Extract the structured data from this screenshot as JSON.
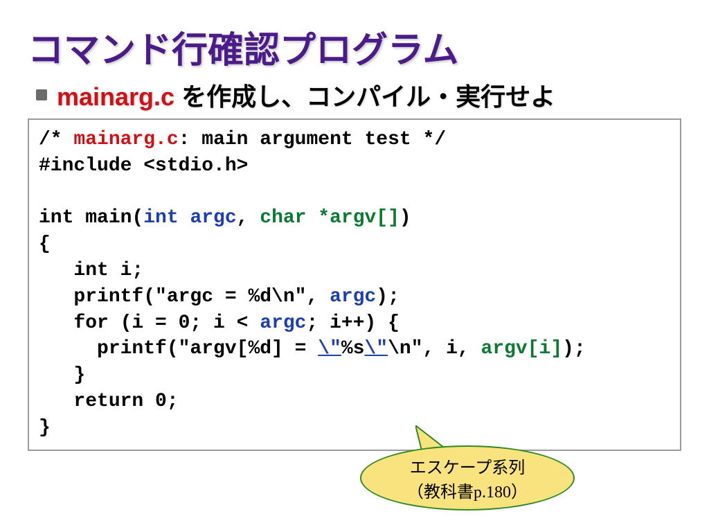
{
  "title": "コマンド行確認プログラム",
  "subtitle_prefix": "mainarg.c",
  "subtitle_rest": " を作成し、コンパイル・実行せよ",
  "code": {
    "l1_a": "/* ",
    "l1_b": "mainarg.c",
    "l1_c": ": main argument test */",
    "l2": "#include <stdio.h>",
    "l3": "",
    "l4_a": "int main(",
    "l4_b": "int argc",
    "l4_c": ", ",
    "l4_d": "char *argv[]",
    "l4_e": ")",
    "l5": "{",
    "l6": "   int i;",
    "l7_a": "   printf(\"argc = %d\\n\", ",
    "l7_b": "argc",
    "l7_c": ");",
    "l8_a": "   for (i = 0; i < ",
    "l8_b": "argc",
    "l8_c": "; i++) {",
    "l9_a": "     printf(\"argv[%d] = ",
    "l9_b": "\\\"",
    "l9_c": "%s",
    "l9_d": "\\\"",
    "l9_e": "\\n\", i, ",
    "l9_f": "argv[i]",
    "l9_g": ");",
    "l10": "   }",
    "l11": "   return 0;",
    "l12": "}"
  },
  "callout": {
    "line1": "エスケープ系列",
    "line2_a": "（教科書",
    "line2_b": "p.180",
    "line2_c": "）"
  }
}
